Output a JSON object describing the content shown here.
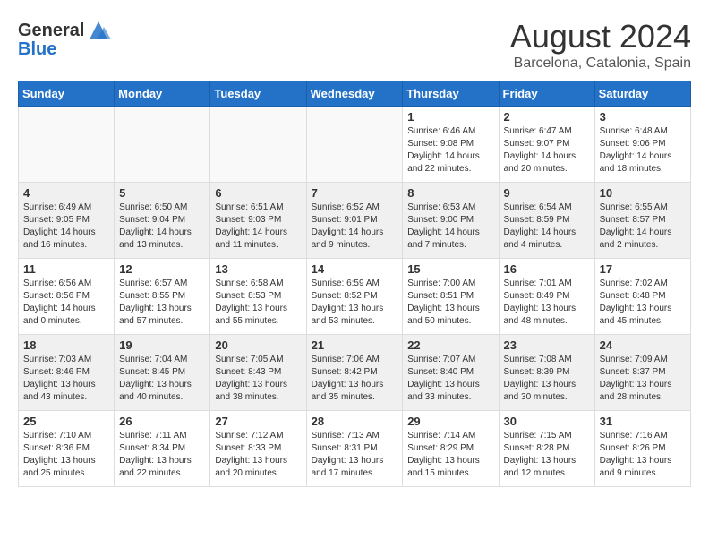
{
  "header": {
    "logo_line1": "General",
    "logo_line2": "Blue",
    "month": "August 2024",
    "location": "Barcelona, Catalonia, Spain"
  },
  "weekdays": [
    "Sunday",
    "Monday",
    "Tuesday",
    "Wednesday",
    "Thursday",
    "Friday",
    "Saturday"
  ],
  "weeks": [
    [
      {
        "day": "",
        "info": ""
      },
      {
        "day": "",
        "info": ""
      },
      {
        "day": "",
        "info": ""
      },
      {
        "day": "",
        "info": ""
      },
      {
        "day": "1",
        "info": "Sunrise: 6:46 AM\nSunset: 9:08 PM\nDaylight: 14 hours\nand 22 minutes."
      },
      {
        "day": "2",
        "info": "Sunrise: 6:47 AM\nSunset: 9:07 PM\nDaylight: 14 hours\nand 20 minutes."
      },
      {
        "day": "3",
        "info": "Sunrise: 6:48 AM\nSunset: 9:06 PM\nDaylight: 14 hours\nand 18 minutes."
      }
    ],
    [
      {
        "day": "4",
        "info": "Sunrise: 6:49 AM\nSunset: 9:05 PM\nDaylight: 14 hours\nand 16 minutes."
      },
      {
        "day": "5",
        "info": "Sunrise: 6:50 AM\nSunset: 9:04 PM\nDaylight: 14 hours\nand 13 minutes."
      },
      {
        "day": "6",
        "info": "Sunrise: 6:51 AM\nSunset: 9:03 PM\nDaylight: 14 hours\nand 11 minutes."
      },
      {
        "day": "7",
        "info": "Sunrise: 6:52 AM\nSunset: 9:01 PM\nDaylight: 14 hours\nand 9 minutes."
      },
      {
        "day": "8",
        "info": "Sunrise: 6:53 AM\nSunset: 9:00 PM\nDaylight: 14 hours\nand 7 minutes."
      },
      {
        "day": "9",
        "info": "Sunrise: 6:54 AM\nSunset: 8:59 PM\nDaylight: 14 hours\nand 4 minutes."
      },
      {
        "day": "10",
        "info": "Sunrise: 6:55 AM\nSunset: 8:57 PM\nDaylight: 14 hours\nand 2 minutes."
      }
    ],
    [
      {
        "day": "11",
        "info": "Sunrise: 6:56 AM\nSunset: 8:56 PM\nDaylight: 14 hours\nand 0 minutes."
      },
      {
        "day": "12",
        "info": "Sunrise: 6:57 AM\nSunset: 8:55 PM\nDaylight: 13 hours\nand 57 minutes."
      },
      {
        "day": "13",
        "info": "Sunrise: 6:58 AM\nSunset: 8:53 PM\nDaylight: 13 hours\nand 55 minutes."
      },
      {
        "day": "14",
        "info": "Sunrise: 6:59 AM\nSunset: 8:52 PM\nDaylight: 13 hours\nand 53 minutes."
      },
      {
        "day": "15",
        "info": "Sunrise: 7:00 AM\nSunset: 8:51 PM\nDaylight: 13 hours\nand 50 minutes."
      },
      {
        "day": "16",
        "info": "Sunrise: 7:01 AM\nSunset: 8:49 PM\nDaylight: 13 hours\nand 48 minutes."
      },
      {
        "day": "17",
        "info": "Sunrise: 7:02 AM\nSunset: 8:48 PM\nDaylight: 13 hours\nand 45 minutes."
      }
    ],
    [
      {
        "day": "18",
        "info": "Sunrise: 7:03 AM\nSunset: 8:46 PM\nDaylight: 13 hours\nand 43 minutes."
      },
      {
        "day": "19",
        "info": "Sunrise: 7:04 AM\nSunset: 8:45 PM\nDaylight: 13 hours\nand 40 minutes."
      },
      {
        "day": "20",
        "info": "Sunrise: 7:05 AM\nSunset: 8:43 PM\nDaylight: 13 hours\nand 38 minutes."
      },
      {
        "day": "21",
        "info": "Sunrise: 7:06 AM\nSunset: 8:42 PM\nDaylight: 13 hours\nand 35 minutes."
      },
      {
        "day": "22",
        "info": "Sunrise: 7:07 AM\nSunset: 8:40 PM\nDaylight: 13 hours\nand 33 minutes."
      },
      {
        "day": "23",
        "info": "Sunrise: 7:08 AM\nSunset: 8:39 PM\nDaylight: 13 hours\nand 30 minutes."
      },
      {
        "day": "24",
        "info": "Sunrise: 7:09 AM\nSunset: 8:37 PM\nDaylight: 13 hours\nand 28 minutes."
      }
    ],
    [
      {
        "day": "25",
        "info": "Sunrise: 7:10 AM\nSunset: 8:36 PM\nDaylight: 13 hours\nand 25 minutes."
      },
      {
        "day": "26",
        "info": "Sunrise: 7:11 AM\nSunset: 8:34 PM\nDaylight: 13 hours\nand 22 minutes."
      },
      {
        "day": "27",
        "info": "Sunrise: 7:12 AM\nSunset: 8:33 PM\nDaylight: 13 hours\nand 20 minutes."
      },
      {
        "day": "28",
        "info": "Sunrise: 7:13 AM\nSunset: 8:31 PM\nDaylight: 13 hours\nand 17 minutes."
      },
      {
        "day": "29",
        "info": "Sunrise: 7:14 AM\nSunset: 8:29 PM\nDaylight: 13 hours\nand 15 minutes."
      },
      {
        "day": "30",
        "info": "Sunrise: 7:15 AM\nSunset: 8:28 PM\nDaylight: 13 hours\nand 12 minutes."
      },
      {
        "day": "31",
        "info": "Sunrise: 7:16 AM\nSunset: 8:26 PM\nDaylight: 13 hours\nand 9 minutes."
      }
    ]
  ]
}
